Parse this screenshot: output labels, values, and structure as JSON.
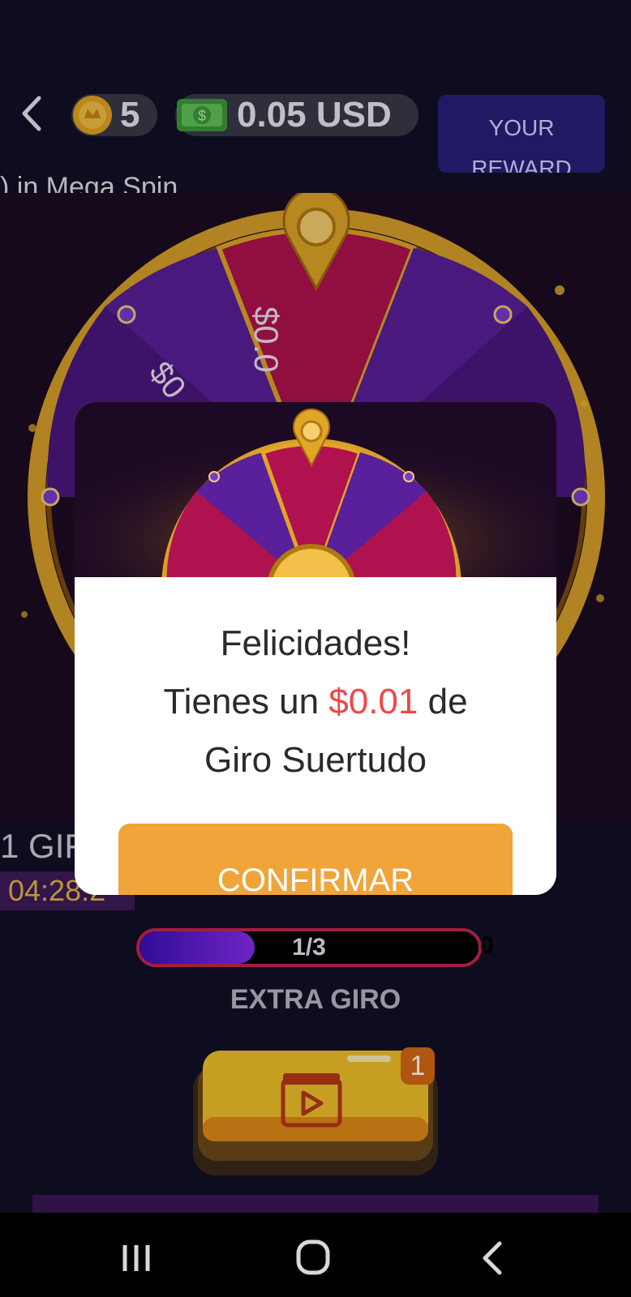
{
  "header": {
    "coins": "5",
    "cash": "0.05 USD",
    "reward_label": "YOUR REWARD",
    "subtitle": ") in Mega Spin"
  },
  "wheel": {
    "visible_segment_top": "$0.0",
    "visible_segment_left": "$0"
  },
  "spins": {
    "count_text": "1 GIF",
    "timer": "04:28:2"
  },
  "progress": {
    "label": "1/3",
    "fraction": 0.34,
    "right_text": "0"
  },
  "extra": {
    "label": "EXTRA GIRO",
    "badge": "1"
  },
  "dialog": {
    "line1": "Felicidades!",
    "line2_prefix": "Tienes un ",
    "line2_amount": "$0.01",
    "line2_suffix": " de",
    "line3": "Giro Suertudo",
    "confirm_label": "CONFIRMAR"
  },
  "colors": {
    "accent": "#f0a43a",
    "amount": "#ef4848",
    "wheel_purple": "#5a1f9a",
    "wheel_magenta": "#b0124f",
    "gold": "#e0a626"
  },
  "icons": {
    "back": "chevron-left-icon",
    "coin": "coin-icon",
    "cash": "cash-icon",
    "video": "video-play-icon",
    "nav_recent": "recents-icon",
    "nav_home": "home-icon",
    "nav_back": "back-icon"
  }
}
